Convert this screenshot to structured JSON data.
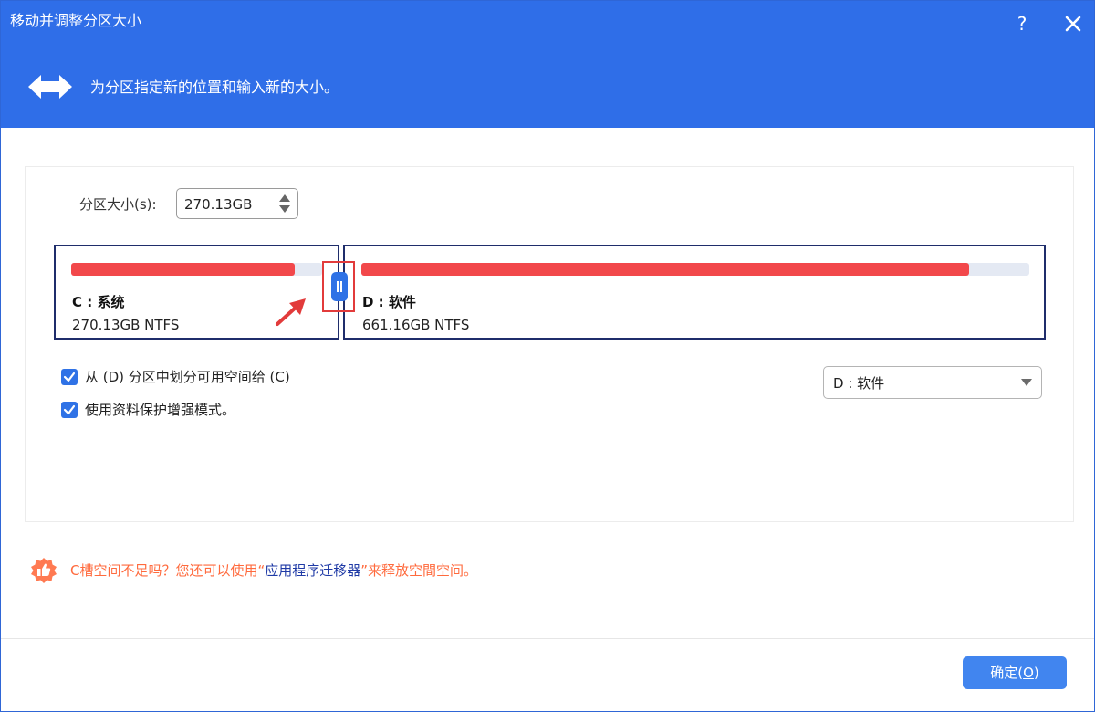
{
  "window": {
    "title": "移动并调整分区大小",
    "help_label": "?"
  },
  "header": {
    "description": "为分区指定新的位置和输入新的大小。"
  },
  "size": {
    "label": "分区大小(s):",
    "value": "270.13GB"
  },
  "partitions": [
    {
      "name": "C : 系统",
      "info": "270.13GB NTFS",
      "used_fraction": 0.89
    },
    {
      "name": "D : 软件",
      "info": "661.16GB NTFS",
      "used_fraction": 0.91
    }
  ],
  "options": [
    {
      "label": "从 (D) 分区中划分可用空间给 (C)",
      "checked": true
    },
    {
      "label": "使用资料保护增强模式。",
      "checked": true
    }
  ],
  "source_select": {
    "value": "D : 软件"
  },
  "tip": {
    "prefix": "C槽空间不足吗？您还可以使用“",
    "link": "应用程序迁移器",
    "suffix": "”来释放空間空间。"
  },
  "ok_button": {
    "label_prefix": "确定(",
    "label_key": "O",
    "label_suffix": ")"
  },
  "colors": {
    "header": "#2f6ee8",
    "partition_border": "#1f2d6b",
    "bar_used": "#f2484b",
    "bar_free": "#e4e9f3",
    "accent": "#2f72e6",
    "tip_text": "#ff6a3d",
    "tip_link": "#1f3aa6",
    "highlight": "#e23b3b"
  }
}
